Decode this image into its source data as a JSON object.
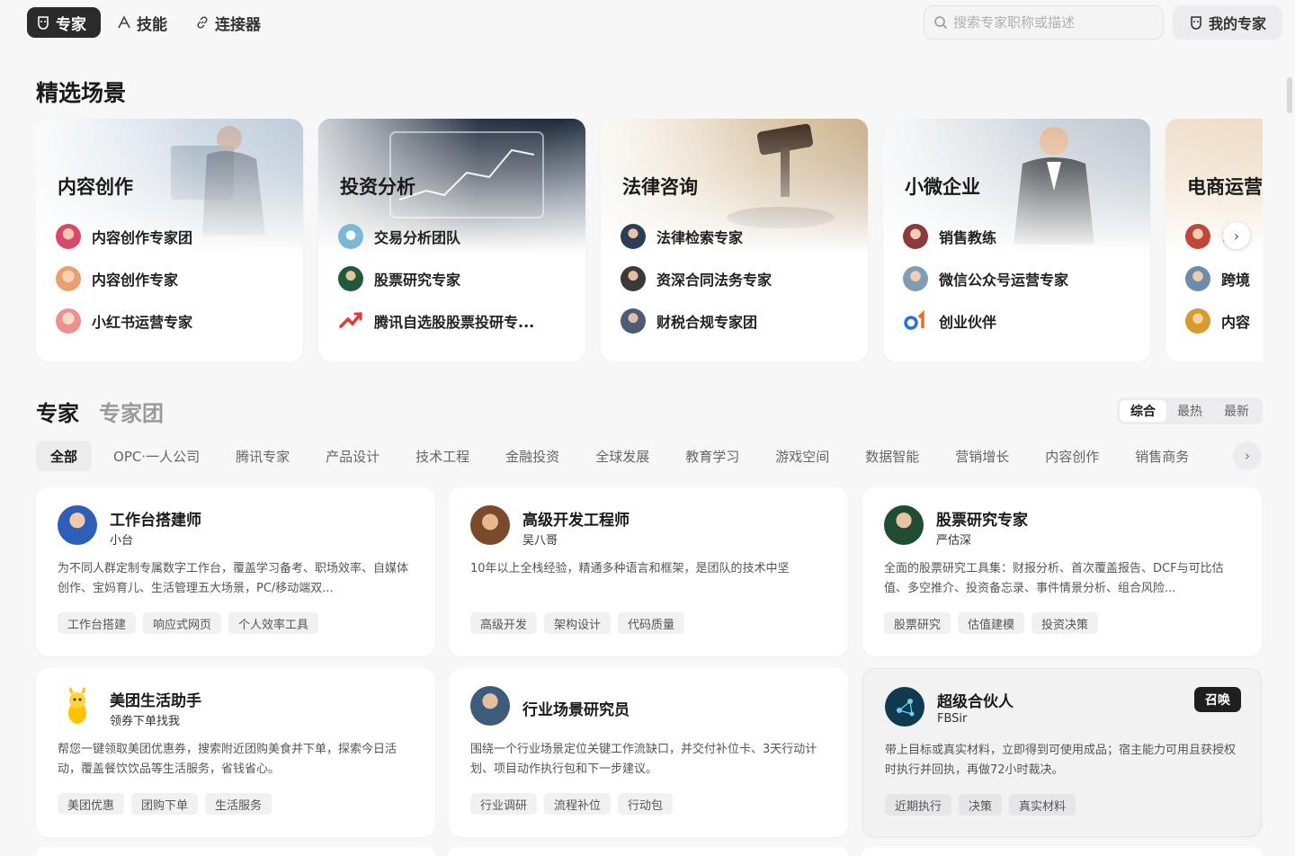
{
  "nav": {
    "tabs": [
      {
        "label": "专家",
        "icon": "expert-icon"
      },
      {
        "label": "技能",
        "icon": "skill-icon"
      },
      {
        "label": "连接器",
        "icon": "link-icon"
      }
    ],
    "search_placeholder": "搜索专家职称或描述",
    "my_experts": "我的专家"
  },
  "featured": {
    "title": "精选场景",
    "scenes": [
      {
        "title": "内容创作",
        "items": [
          "内容创作专家团",
          "内容创作专家",
          "小红书运营专家"
        ]
      },
      {
        "title": "投资分析",
        "items": [
          "交易分析团队",
          "股票研究专家",
          "腾讯自选股股票投研专..."
        ]
      },
      {
        "title": "法律咨询",
        "items": [
          "法律检索专家",
          "资深合同法务专家",
          "财税合规专家团"
        ]
      },
      {
        "title": "小微企业",
        "items": [
          "销售教练",
          "微信公众号运营专家",
          "创业伙伴"
        ]
      },
      {
        "title": "电商运营",
        "items": [
          "1",
          "跨境",
          "内容"
        ]
      }
    ]
  },
  "experts": {
    "tab_expert": "专家",
    "tab_team": "专家团",
    "sort": [
      "综合",
      "最热",
      "最新"
    ],
    "categories": [
      "全部",
      "OPC·一人公司",
      "腾讯专家",
      "产品设计",
      "技术工程",
      "金融投资",
      "全球发展",
      "教育学习",
      "游戏空间",
      "数据智能",
      "营销增长",
      "内容创作",
      "销售商务"
    ],
    "cards": [
      {
        "name": "工作台搭建师",
        "author": "小台",
        "desc": "为不同人群定制专属数字工作台，覆盖学习备考、职场效率、自媒体创作、宝妈育儿、生活管理五大场景，PC/移动端双...",
        "tags": [
          "工作台搭建",
          "响应式网页",
          "个人效率工具"
        ]
      },
      {
        "name": "高级开发工程师",
        "author": "吴八哥",
        "desc": "10年以上全栈经验，精通多种语言和框架，是团队的技术中坚",
        "tags": [
          "高级开发",
          "架构设计",
          "代码质量"
        ]
      },
      {
        "name": "股票研究专家",
        "author": "严估深",
        "desc": "全面的股票研究工具集：财报分析、首次覆盖报告、DCF与可比估值、多空推介、投资备忘录、事件情景分析、组合风险...",
        "tags": [
          "股票研究",
          "估值建模",
          "投资决策"
        ]
      },
      {
        "name": "美团生活助手",
        "author": "领券下单找我",
        "desc": "帮您一键领取美团优惠券，搜索附近团购美食并下单，探索今日活动，覆盖餐饮饮品等生活服务，省钱省心。",
        "tags": [
          "美团优惠",
          "团购下单",
          "生活服务"
        ]
      },
      {
        "name": "行业场景研究员",
        "author": "",
        "desc": "围绕一个行业场景定位关键工作流缺口，并交付补位卡、3天行动计划、项目动作执行包和下一步建议。",
        "tags": [
          "行业调研",
          "流程补位",
          "行动包"
        ]
      },
      {
        "name": "超级合伙人",
        "author": "FBSir",
        "desc": "带上目标或真实材料，立即得到可使用成品；宿主能力可用且获授权时执行并回执，再做72小时裁决。",
        "tags": [
          "近期执行",
          "决策",
          "真实材料"
        ],
        "badge": "召唤"
      }
    ]
  }
}
